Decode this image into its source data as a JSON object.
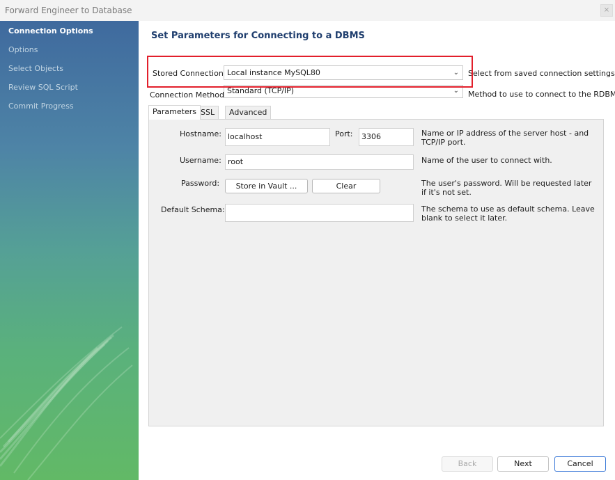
{
  "window": {
    "title": "Forward Engineer to Database",
    "close_glyph": "×"
  },
  "sidebar": {
    "items": [
      {
        "label": "Connection Options",
        "active": true
      },
      {
        "label": "Options"
      },
      {
        "label": "Select Objects"
      },
      {
        "label": "Review SQL Script"
      },
      {
        "label": "Commit Progress"
      }
    ]
  },
  "main": {
    "title": "Set Parameters for Connecting to a DBMS",
    "stored_connection": {
      "label": "Stored Connection:",
      "value": "Local instance MySQL80",
      "hint": "Select from saved connection settings"
    },
    "connection_method": {
      "label": "Connection Method:",
      "value": "Standard (TCP/IP)",
      "hint": "Method to use to connect to the RDBMS"
    },
    "tabs": [
      {
        "label": "Parameters",
        "active": true
      },
      {
        "label": "SSL"
      },
      {
        "label": "Advanced"
      }
    ],
    "params": {
      "hostname_label": "Hostname:",
      "hostname_value": "localhost",
      "port_label": "Port:",
      "port_value": "3306",
      "hostname_desc": "Name or IP address of the server host - and TCP/IP port.",
      "username_label": "Username:",
      "username_value": "root",
      "username_desc": "Name of the user to connect with.",
      "password_label": "Password:",
      "store_vault_label": "Store in Vault ...",
      "clear_label": "Clear",
      "password_desc": "The user's password. Will be requested later if it's not set.",
      "schema_label": "Default Schema:",
      "schema_value": "",
      "schema_desc": "The schema to use as default schema. Leave blank to select it later."
    }
  },
  "footer": {
    "back_label": "Back",
    "next_label": "Next",
    "cancel_label": "Cancel"
  },
  "colors": {
    "highlight": "#e21f2b",
    "title": "#1f3e6e",
    "primary_border": "#3c7ad8"
  }
}
